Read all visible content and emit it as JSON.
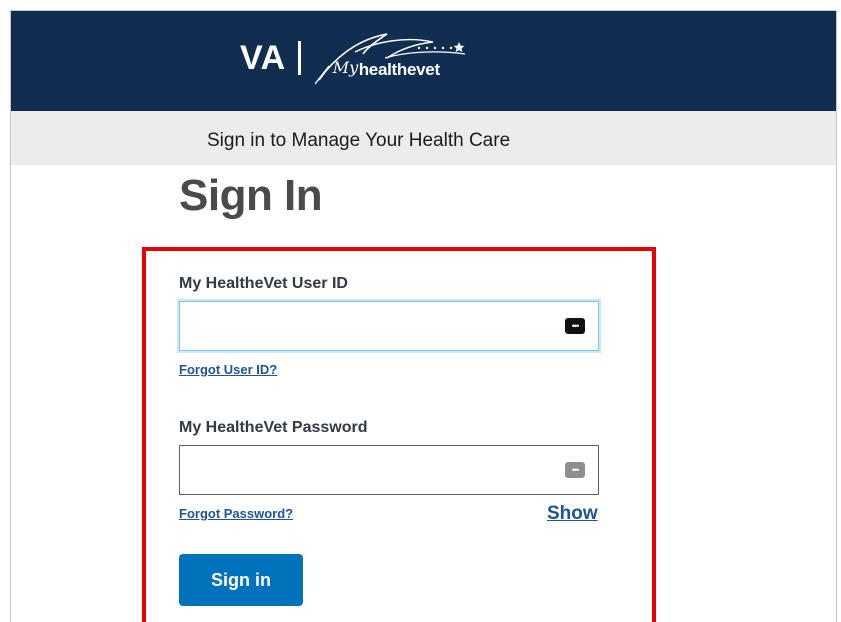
{
  "header": {
    "logo_va": "VA",
    "logo_my": "My",
    "logo_healthevet": "healthevet"
  },
  "subheader": {
    "title": "Sign in to Manage Your Health Care"
  },
  "main": {
    "title": "Sign In"
  },
  "form": {
    "user_id_label": "My HealtheVet User ID",
    "user_id_value": "",
    "forgot_user_id": "Forgot User ID?",
    "password_label": "My HealtheVet Password",
    "password_value": "",
    "forgot_password": "Forgot Password?",
    "show_label": "Show",
    "submit_label": "Sign in",
    "password_manager_icon": "password-manager-icon",
    "highlight_color": "#e60000"
  },
  "colors": {
    "header_bg": "#112e51",
    "subheader_bg": "#ececec",
    "primary_button": "#0071bb",
    "link": "#205493"
  }
}
